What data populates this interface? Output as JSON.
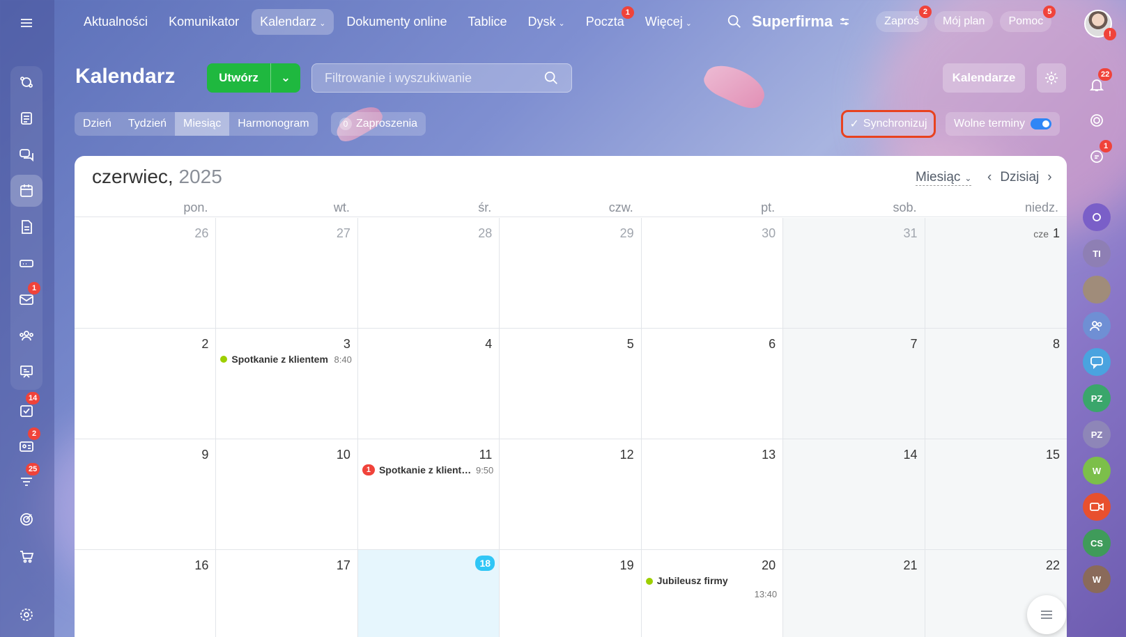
{
  "topnav": {
    "items": [
      {
        "label": "Aktualności"
      },
      {
        "label": "Komunikator"
      },
      {
        "label": "Kalendarz",
        "dropdown": true,
        "active": true
      },
      {
        "label": "Dokumenty online"
      },
      {
        "label": "Tablice"
      },
      {
        "label": "Dysk",
        "dropdown": true
      },
      {
        "label": "Poczta",
        "badge": "1"
      },
      {
        "label": "Więcej",
        "dropdown": true
      }
    ],
    "brand": "Superfirma",
    "invite": {
      "label": "Zaproś",
      "badge": "2"
    },
    "plan": "Mój plan",
    "help": {
      "label": "Pomoc",
      "badge": "5"
    }
  },
  "leftbar": {
    "badges": {
      "mail": "1",
      "tasks": "14",
      "crm": "2",
      "feed": "25"
    }
  },
  "rightbar": {
    "bell_badge": "22",
    "chat_badge": "1",
    "avatars": [
      "TI",
      "PZ",
      "PZ",
      "W",
      "CS",
      "W"
    ]
  },
  "header": {
    "title": "Kalendarz",
    "create_label": "Utwórz",
    "search_placeholder": "Filtrowanie i wyszukiwanie",
    "calendars_label": "Kalendarze"
  },
  "views": {
    "tabs": [
      "Dzień",
      "Tydzień",
      "Miesiąc",
      "Harmonogram"
    ],
    "active": "Miesiąc",
    "invites_count": "0",
    "invites_label": "Zaproszenia",
    "sync_label": "Synchronizuj",
    "free_label": "Wolne terminy"
  },
  "calendar": {
    "month": "czerwiec,",
    "year": "2025",
    "view_select": "Miesiąc",
    "today_label": "Dzisiaj",
    "weekdays": [
      "pon.",
      "wt.",
      "śr.",
      "czw.",
      "pt.",
      "sob.",
      "niedz."
    ],
    "month_prefix": "cze",
    "days": [
      "26",
      "27",
      "28",
      "29",
      "30",
      "31",
      "1",
      "2",
      "3",
      "4",
      "5",
      "6",
      "7",
      "8",
      "9",
      "10",
      "11",
      "12",
      "13",
      "14",
      "15",
      "16",
      "17",
      "18",
      "19",
      "20",
      "21",
      "22"
    ],
    "events": [
      {
        "day": "3",
        "title": "Spotkanie z klientem",
        "time": "8:40"
      },
      {
        "day": "11",
        "title": "Spotkanie z klientem",
        "time": "9:50",
        "badge": "1"
      },
      {
        "day": "20",
        "title": "Jubileusz firmy",
        "time": "13:40"
      }
    ],
    "today": "18"
  }
}
